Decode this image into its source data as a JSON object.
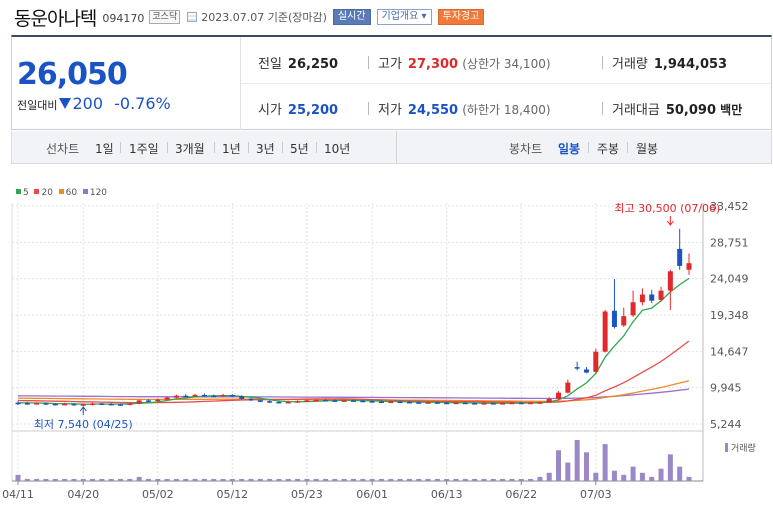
{
  "header": {
    "name": "동운아나텍",
    "code": "094170",
    "market": "코스닥",
    "datetime": "2023.07.07 기준(장마감)",
    "realtime": "실시간",
    "overview": "기업개요 ▾",
    "warning": "투자경고"
  },
  "summary": {
    "price": "26,050",
    "change_label": "전일대비",
    "change": "200",
    "change_pct": "-0.76%",
    "prev_label": "전일",
    "prev": "26,250",
    "open_label": "시가",
    "open": "25,200",
    "high_label": "고가",
    "high": "27,300",
    "upper_label": "(상한가 34,100)",
    "low_label": "저가",
    "low": "24,550",
    "lower_label": "(하한가 18,400)",
    "volume_label": "거래량",
    "volume": "1,944,053",
    "amount_label": "거래대금",
    "amount": "50,090",
    "amount_unit": "백만"
  },
  "toolbar": {
    "line_label": "선차트",
    "periods": [
      "1일",
      "1주일",
      "3개월",
      "1년",
      "3년",
      "5년",
      "10년"
    ],
    "candle_label": "봉차트",
    "candles": [
      "일봉",
      "주봉",
      "월봉"
    ],
    "selected_candle": "일봉"
  },
  "legend": [
    {
      "label": "5",
      "color": "#2fa84f"
    },
    {
      "label": "20",
      "color": "#e84b4b"
    },
    {
      "label": "60",
      "color": "#f08a24"
    },
    {
      "label": "120",
      "color": "#9b6fd0"
    }
  ],
  "colors": {
    "up": "#e0282d",
    "down": "#1a54c4",
    "vol": "#9a88c8"
  },
  "annotations": {
    "high": "최고 30,500 (07/06)",
    "low": "최저 7,540 (04/25)",
    "vol_label": "거래량"
  },
  "chart_data": {
    "type": "candlestick",
    "y_ticks": [
      "33,452",
      "28,751",
      "24,049",
      "19,348",
      "14,647",
      "9,945",
      "5,244"
    ],
    "ylim": [
      5244,
      33452
    ],
    "x_ticks": [
      "04/11",
      "04/20",
      "05/02",
      "05/12",
      "05/23",
      "06/01",
      "06/13",
      "06/22",
      "07/03"
    ],
    "candles": [
      {
        "o": 8000,
        "c": 7950,
        "h": 8200,
        "l": 7700
      },
      {
        "o": 7950,
        "c": 7900,
        "h": 8100,
        "l": 7750
      },
      {
        "o": 7900,
        "c": 7950,
        "h": 8050,
        "l": 7800
      },
      {
        "o": 7950,
        "c": 7850,
        "h": 8050,
        "l": 7700
      },
      {
        "o": 7850,
        "c": 7800,
        "h": 7950,
        "l": 7650
      },
      {
        "o": 7800,
        "c": 7850,
        "h": 8000,
        "l": 7700
      },
      {
        "o": 7850,
        "c": 7750,
        "h": 7950,
        "l": 7600
      },
      {
        "o": 7750,
        "c": 7800,
        "h": 7900,
        "l": 7540
      },
      {
        "o": 7800,
        "c": 7900,
        "h": 8050,
        "l": 7650
      },
      {
        "o": 7900,
        "c": 7850,
        "h": 8000,
        "l": 7700
      },
      {
        "o": 7850,
        "c": 7800,
        "h": 7950,
        "l": 7650
      },
      {
        "o": 7800,
        "c": 7750,
        "h": 7900,
        "l": 7600
      },
      {
        "o": 7750,
        "c": 7900,
        "h": 8000,
        "l": 7650
      },
      {
        "o": 7900,
        "c": 8300,
        "h": 8400,
        "l": 7800
      },
      {
        "o": 8300,
        "c": 8200,
        "h": 8450,
        "l": 8050
      },
      {
        "o": 8200,
        "c": 8400,
        "h": 8550,
        "l": 8100
      },
      {
        "o": 8400,
        "c": 8650,
        "h": 8800,
        "l": 8300
      },
      {
        "o": 8650,
        "c": 8900,
        "h": 9050,
        "l": 8550
      },
      {
        "o": 8900,
        "c": 8800,
        "h": 9100,
        "l": 8700
      },
      {
        "o": 8800,
        "c": 9000,
        "h": 9150,
        "l": 8700
      },
      {
        "o": 9000,
        "c": 8900,
        "h": 9200,
        "l": 8750
      },
      {
        "o": 8900,
        "c": 8850,
        "h": 9050,
        "l": 8700
      },
      {
        "o": 8850,
        "c": 9000,
        "h": 9150,
        "l": 8750
      },
      {
        "o": 9000,
        "c": 8850,
        "h": 9100,
        "l": 8700
      },
      {
        "o": 8850,
        "c": 8500,
        "h": 8950,
        "l": 8400
      },
      {
        "o": 8500,
        "c": 8300,
        "h": 8600,
        "l": 8200
      },
      {
        "o": 8300,
        "c": 8200,
        "h": 8400,
        "l": 8100
      },
      {
        "o": 8200,
        "c": 8100,
        "h": 8300,
        "l": 7950
      },
      {
        "o": 8100,
        "c": 8000,
        "h": 8200,
        "l": 7900
      },
      {
        "o": 8000,
        "c": 8100,
        "h": 8250,
        "l": 7900
      },
      {
        "o": 8100,
        "c": 8200,
        "h": 8300,
        "l": 8000
      },
      {
        "o": 8200,
        "c": 8300,
        "h": 8400,
        "l": 8100
      },
      {
        "o": 8300,
        "c": 8350,
        "h": 8450,
        "l": 8200
      },
      {
        "o": 8350,
        "c": 8300,
        "h": 8450,
        "l": 8200
      },
      {
        "o": 8300,
        "c": 8250,
        "h": 8400,
        "l": 8150
      },
      {
        "o": 8250,
        "c": 8300,
        "h": 8400,
        "l": 8150
      },
      {
        "o": 8300,
        "c": 8250,
        "h": 8400,
        "l": 8150
      },
      {
        "o": 8250,
        "c": 8200,
        "h": 8350,
        "l": 8100
      },
      {
        "o": 8200,
        "c": 8150,
        "h": 8300,
        "l": 8050
      },
      {
        "o": 8150,
        "c": 8100,
        "h": 8250,
        "l": 8000
      },
      {
        "o": 8100,
        "c": 8150,
        "h": 8250,
        "l": 8000
      },
      {
        "o": 8150,
        "c": 8100,
        "h": 8250,
        "l": 8000
      },
      {
        "o": 8100,
        "c": 8050,
        "h": 8200,
        "l": 7950
      },
      {
        "o": 8050,
        "c": 8000,
        "h": 8150,
        "l": 7900
      },
      {
        "o": 8000,
        "c": 8050,
        "h": 8150,
        "l": 7900
      },
      {
        "o": 8050,
        "c": 8000,
        "h": 8150,
        "l": 7900
      },
      {
        "o": 8000,
        "c": 7950,
        "h": 8100,
        "l": 7850
      },
      {
        "o": 7950,
        "c": 8000,
        "h": 8100,
        "l": 7850
      },
      {
        "o": 8000,
        "c": 7950,
        "h": 8100,
        "l": 7850
      },
      {
        "o": 7950,
        "c": 7900,
        "h": 8050,
        "l": 7800
      },
      {
        "o": 7900,
        "c": 7950,
        "h": 8050,
        "l": 7800
      },
      {
        "o": 7950,
        "c": 7900,
        "h": 8050,
        "l": 7800
      },
      {
        "o": 7900,
        "c": 7950,
        "h": 8050,
        "l": 7800
      },
      {
        "o": 7950,
        "c": 8000,
        "h": 8100,
        "l": 7850
      },
      {
        "o": 8000,
        "c": 7950,
        "h": 8100,
        "l": 7850
      },
      {
        "o": 7950,
        "c": 8000,
        "h": 8100,
        "l": 7850
      },
      {
        "o": 8000,
        "c": 8050,
        "h": 8150,
        "l": 7900
      },
      {
        "o": 8050,
        "c": 8500,
        "h": 8700,
        "l": 8000
      },
      {
        "o": 8500,
        "c": 9300,
        "h": 9500,
        "l": 8400
      },
      {
        "o": 9300,
        "c": 10600,
        "h": 11000,
        "l": 9200
      },
      {
        "o": 12600,
        "c": 12500,
        "h": 13300,
        "l": 12200
      },
      {
        "o": 12300,
        "c": 11900,
        "h": 12600,
        "l": 11800
      },
      {
        "o": 12000,
        "c": 14600,
        "h": 15000,
        "l": 11900
      },
      {
        "o": 14600,
        "c": 19800,
        "h": 20000,
        "l": 14500
      },
      {
        "o": 19900,
        "c": 17800,
        "h": 24000,
        "l": 17600
      },
      {
        "o": 18000,
        "c": 19200,
        "h": 20300,
        "l": 17800
      },
      {
        "o": 19300,
        "c": 21000,
        "h": 22500,
        "l": 19100
      },
      {
        "o": 21000,
        "c": 22000,
        "h": 22800,
        "l": 20600
      },
      {
        "o": 22000,
        "c": 21200,
        "h": 22600,
        "l": 20900
      },
      {
        "o": 21300,
        "c": 22500,
        "h": 23000,
        "l": 21000
      },
      {
        "o": 22500,
        "c": 25000,
        "h": 25200,
        "l": 20000
      },
      {
        "o": 27900,
        "c": 25700,
        "h": 30500,
        "l": 25200
      },
      {
        "o": 25200,
        "c": 26050,
        "h": 27300,
        "l": 24550
      }
    ],
    "volume": [
      3,
      1,
      1,
      1,
      1,
      1,
      1,
      1,
      1,
      1,
      1,
      1,
      1,
      2,
      1,
      1,
      1,
      1,
      1,
      1,
      1,
      1,
      1,
      1,
      1,
      1,
      1,
      1,
      1,
      1,
      1,
      1,
      1,
      1,
      1,
      1,
      1,
      1,
      1,
      1,
      1,
      1,
      1,
      1,
      1,
      1,
      1,
      1,
      1,
      1,
      1,
      1,
      1,
      1,
      1,
      1,
      2,
      4,
      15,
      9,
      20,
      14,
      4,
      18,
      5,
      3,
      7,
      4,
      2,
      6,
      13,
      7,
      2
    ]
  }
}
